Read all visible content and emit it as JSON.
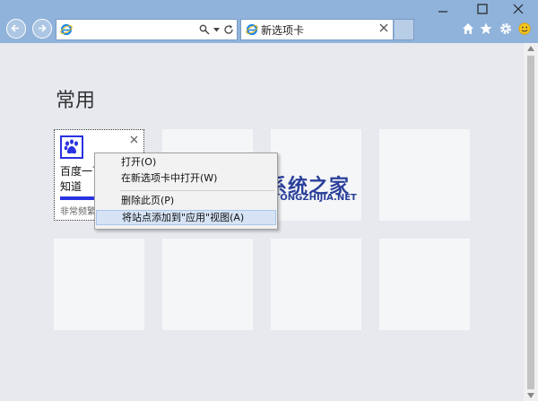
{
  "browser": {
    "tab_title": "新选项卡",
    "address_value": ""
  },
  "page": {
    "heading": "常用",
    "tiles": [
      {
        "title": "百度一下，你就知道",
        "note": "非常频繁"
      }
    ]
  },
  "context_menu": {
    "items": [
      "打开(O)",
      "在新选项卡中打开(W)",
      "删除此页(P)",
      "将站点添加到\"应用\"视图(A)"
    ]
  },
  "watermark": {
    "text": "系统之家",
    "sub": "XITONGZHIJIA.NET"
  },
  "colors": {
    "titlebar": "#90b3db",
    "baidu_blue": "#2932e1",
    "menu_highlight": "#d5e3f5"
  }
}
